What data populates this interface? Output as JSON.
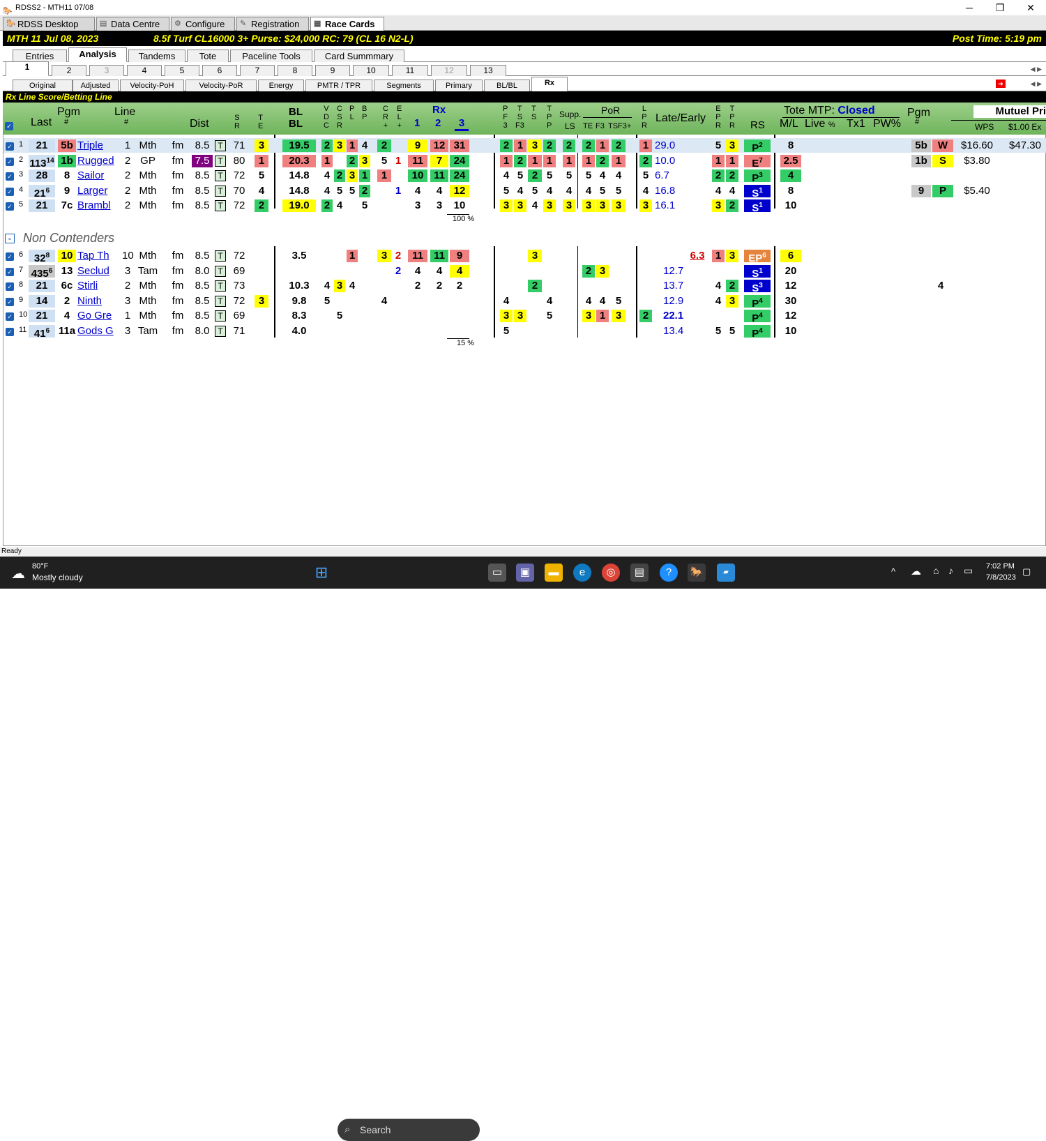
{
  "window": {
    "title": "RDSS2 - MTH11  07/08"
  },
  "app_tabs": [
    "RDSS Desktop",
    "Data Centre",
    "Configure",
    "Registration",
    "Race Cards"
  ],
  "race": {
    "info": "MTH  11   Jul 08, 2023",
    "details": "8.5f  Turf  CL16000  3+   Purse: $24,000   RC: 79  (CL 16 N2-L)",
    "post_time": "Post Time: 5:19 pm"
  },
  "tabs_main": [
    "Entries",
    "Analysis",
    "Tandems",
    "Tote",
    "Paceline Tools",
    "Card Summmary"
  ],
  "race_numbers": [
    "1",
    "2",
    "3",
    "4",
    "5",
    "6",
    "7",
    "8",
    "9",
    "10",
    "11",
    "12",
    "13"
  ],
  "tabs_sub": [
    "Original",
    "Adjusted",
    "Velocity-PoH",
    "Velocity-PoR",
    "Energy",
    "PMTR / TPR",
    "Segments",
    "Primary",
    "BL/BL",
    "Rx"
  ],
  "panel_title": "Rx Line Score/Betting Line",
  "headers": {
    "last": "Last",
    "pgm": "Pgm",
    "pgm_sub": "#",
    "line": "Line",
    "line_sub": "#",
    "dist": "Dist",
    "s": "S",
    "r": "R",
    "t": "T",
    "e": "E",
    "bl": "BL",
    "bl2": "BL",
    "v": "V",
    "d": "D",
    "c": "C",
    "cs": "C",
    "s2": "S",
    "r2": "R",
    "p": "P",
    "l": "L",
    "b": "B",
    "pp": "P",
    "c2": "C",
    "r3": "R",
    "plus": "+",
    "e2": "E",
    "l2": "L",
    "plus2": "+",
    "rx": "Rx",
    "rx1": "1",
    "rx2": "2",
    "rx3": "3",
    "pf": "P",
    "f": "F",
    "f3": "3",
    "tsf": "T",
    "s3": "S",
    "f3b": "F3",
    "ts": "T",
    "s4": "S",
    "tp": "T",
    "p2": "P",
    "p3": "P",
    "supp": "Supp.",
    "ls": "LS",
    "por": "PoR",
    "te": "TE",
    "f3c": "F3",
    "tsf3": "TSF3+",
    "lpr_l": "L",
    "lpr_p": "P",
    "lpr_r": "R",
    "late": "Late/Early",
    "epr_e": "E",
    "epr_p": "P",
    "epr_r": "R",
    "tpr_t": "T",
    "tpr_p": "P",
    "tpr_r": "R",
    "rs": "RS",
    "tote": "Tote MTP:",
    "closed": "Closed",
    "ml": "M/L",
    "live": "Live",
    "pct": "%",
    "tx1": "Tx1",
    "pw": "PW%",
    "pgm2": "Pgm",
    "pgm2sub": "#",
    "mutuel": "Mutuel Pri",
    "wps": "WPS",
    "ex": "$1.00 Ex"
  },
  "contenders": [
    {
      "n": "1",
      "last": "21",
      "lastsup": "",
      "pgm": "5b",
      "name": "Triple",
      "line": "1",
      "trk": "Mth",
      "sf": "fm",
      "dist": "8.5",
      "sr": "71",
      "te": "3",
      "bl": "19.5",
      "vdc": "2",
      "csr": "3",
      "pl": "1",
      "bp": "4",
      "cr": "2",
      "el": "",
      "rx1": "9",
      "rx2": "12",
      "rx3": "31",
      "pf3": "2",
      "tsf3": "1",
      "ts": "3",
      "tp": "2",
      "ls": "2",
      "por1": "2",
      "por2": "1",
      "por3": "2",
      "lpr": "1",
      "late": "29.0",
      "epr": "5",
      "tpr": "3",
      "rs": "P",
      "rss": "2",
      "ml": "8",
      "pgm2": "5b",
      "pool": "W",
      "price": "$16.60",
      "ex": "$47.30"
    },
    {
      "n": "2",
      "last": "113",
      "lastsup": "14",
      "pgm": "1b",
      "name": "Rugged",
      "line": "2",
      "trk": "GP",
      "sf": "fm",
      "dist": "7.5",
      "sr": "80",
      "te": "1",
      "bl": "20.3",
      "vdc": "1",
      "csr": "",
      "pl": "2",
      "bp": "3",
      "cr": "5",
      "el": "1",
      "rx1": "11",
      "rx2": "7",
      "rx3": "24",
      "pf3": "1",
      "tsf3": "2",
      "ts": "1",
      "tp": "1",
      "ls": "1",
      "por1": "1",
      "por2": "2",
      "por3": "1",
      "lpr": "2",
      "late": "10.0",
      "epr": "1",
      "tpr": "1",
      "rs": "E",
      "rss": "7",
      "ml": "2.5",
      "pgm2": "1b",
      "pool": "S",
      "price": "$3.80",
      "ex": ""
    },
    {
      "n": "3",
      "last": "28",
      "lastsup": "",
      "pgm": "8",
      "name": "Sailor",
      "line": "2",
      "trk": "Mth",
      "sf": "fm",
      "dist": "8.5",
      "sr": "72",
      "te": "5",
      "bl": "14.8",
      "vdc": "4",
      "csr": "2",
      "pl": "3",
      "bp": "1",
      "cr": "1",
      "el": "",
      "rx1": "10",
      "rx2": "11",
      "rx3": "24",
      "pf3": "4",
      "tsf3": "5",
      "ts": "2",
      "tp": "5",
      "ls": "5",
      "por1": "5",
      "por2": "4",
      "por3": "4",
      "lpr": "5",
      "late": "6.7",
      "epr": "2",
      "tpr": "2",
      "rs": "P",
      "rss": "3",
      "ml": "4",
      "pgm2": "",
      "pool": "",
      "price": "",
      "ex": ""
    },
    {
      "n": "4",
      "last": "21",
      "lastsup": "6",
      "pgm": "9",
      "name": "Larger",
      "line": "2",
      "trk": "Mth",
      "sf": "fm",
      "dist": "8.5",
      "sr": "70",
      "te": "4",
      "bl": "14.8",
      "vdc": "4",
      "csr": "5",
      "pl": "5",
      "bp": "2",
      "cr": "",
      "el": "1",
      "rx1": "4",
      "rx2": "4",
      "rx3": "12",
      "pf3": "5",
      "tsf3": "4",
      "ts": "5",
      "tp": "4",
      "ls": "4",
      "por1": "4",
      "por2": "5",
      "por3": "5",
      "lpr": "4",
      "late": "16.8",
      "epr": "4",
      "tpr": "4",
      "rs": "S",
      "rss": "1",
      "ml": "8",
      "pgm2": "9",
      "pool": "P",
      "price": "$5.40",
      "ex": ""
    },
    {
      "n": "5",
      "last": "21",
      "lastsup": "",
      "pgm": "7c",
      "name": "Brambl",
      "line": "2",
      "trk": "Mth",
      "sf": "fm",
      "dist": "8.5",
      "sr": "72",
      "te": "2",
      "bl": "19.0",
      "vdc": "2",
      "csr": "4",
      "pl": "",
      "bp": "5",
      "cr": "",
      "el": "",
      "rx1": "3",
      "rx2": "3",
      "rx3": "10",
      "pf3": "3",
      "tsf3": "3",
      "ts": "4",
      "tp": "3",
      "ls": "3",
      "por1": "3",
      "por2": "3",
      "por3": "3",
      "lpr": "3",
      "late": "16.1",
      "epr": "3",
      "tpr": "2",
      "rs": "S",
      "rss": "1",
      "ml": "10",
      "pgm2": "",
      "pool": "",
      "price": "",
      "ex": ""
    }
  ],
  "pct1": "100 %",
  "non_label": "Non Contenders",
  "noncontenders": [
    {
      "n": "6",
      "last": "32",
      "lastsup": "8",
      "pgm": "10",
      "name": "Tap Th",
      "line": "10",
      "trk": "Mth",
      "sf": "fm",
      "dist": "8.5",
      "sr": "72",
      "bl": "3.5",
      "pl": "1",
      "cr": "3",
      "el": "2",
      "rx1": "11",
      "rx2": "11",
      "rx3": "9",
      "ts": "3",
      "late_r": "6.3",
      "epr": "1",
      "tpr": "3",
      "rs": "EP",
      "rss": "6",
      "ml": "6"
    },
    {
      "n": "7",
      "last": "435",
      "lastsup": "6",
      "pgm": "13",
      "name": "Seclud",
      "line": "3",
      "trk": "Tam",
      "sf": "fm",
      "dist": "8.0",
      "sr": "69",
      "el": "2",
      "rx1": "4",
      "rx2": "4",
      "rx3": "4",
      "por1": "2",
      "por2": "3",
      "late": "12.7",
      "rs": "S",
      "rss": "1",
      "ml": "20"
    },
    {
      "n": "8",
      "last": "21",
      "lastsup": "",
      "pgm": "6c",
      "name": "Stirli",
      "line": "2",
      "trk": "Mth",
      "sf": "fm",
      "dist": "8.5",
      "sr": "73",
      "bl": "10.3",
      "vdc": "4",
      "csr": "3",
      "pl": "4",
      "rx1": "2",
      "rx2": "2",
      "rx3": "2",
      "ts": "2",
      "late": "13.7",
      "epr": "4",
      "tpr": "2",
      "rs": "S",
      "rss": "3",
      "ml": "12",
      "extra": "4"
    },
    {
      "n": "9",
      "last": "14",
      "lastsup": "",
      "pgm": "2",
      "name": "Ninth",
      "line": "3",
      "trk": "Mth",
      "sf": "fm",
      "dist": "8.5",
      "sr": "72",
      "te": "3",
      "bl": "9.8",
      "vdc": "5",
      "cr": "4",
      "pf3": "4",
      "tp": "4",
      "por1": "4",
      "por2": "4",
      "por3": "5",
      "late": "12.9",
      "epr": "4",
      "tpr": "3",
      "rs": "P",
      "rss": "4",
      "ml": "30"
    },
    {
      "n": "10",
      "last": "21",
      "lastsup": "",
      "pgm": "4",
      "name": "Go Gre",
      "line": "1",
      "trk": "Mth",
      "sf": "fm",
      "dist": "8.5",
      "sr": "69",
      "bl": "8.3",
      "csr": "5",
      "pf3": "3",
      "tsf3": "3",
      "tp": "5",
      "por1": "3",
      "por2": "1",
      "por3": "3",
      "lpr": "2",
      "late": "22.1",
      "rs": "P",
      "rss": "4",
      "ml": "12"
    },
    {
      "n": "11",
      "last": "41",
      "lastsup": "6",
      "pgm": "11a",
      "name": "Gods G",
      "line": "3",
      "trk": "Tam",
      "sf": "fm",
      "dist": "8.0",
      "sr": "71",
      "bl": "4.0",
      "pf3": "5",
      "late": "13.4",
      "epr": "5",
      "tpr": "5",
      "rs": "P",
      "rss": "4",
      "ml": "10"
    }
  ],
  "pct2": "15 %",
  "status": "Ready",
  "weather": {
    "temp": "80°F",
    "desc": "Mostly cloudy"
  },
  "search_placeholder": "Search",
  "clock": {
    "time": "7:02 PM",
    "date": "7/8/2023"
  }
}
